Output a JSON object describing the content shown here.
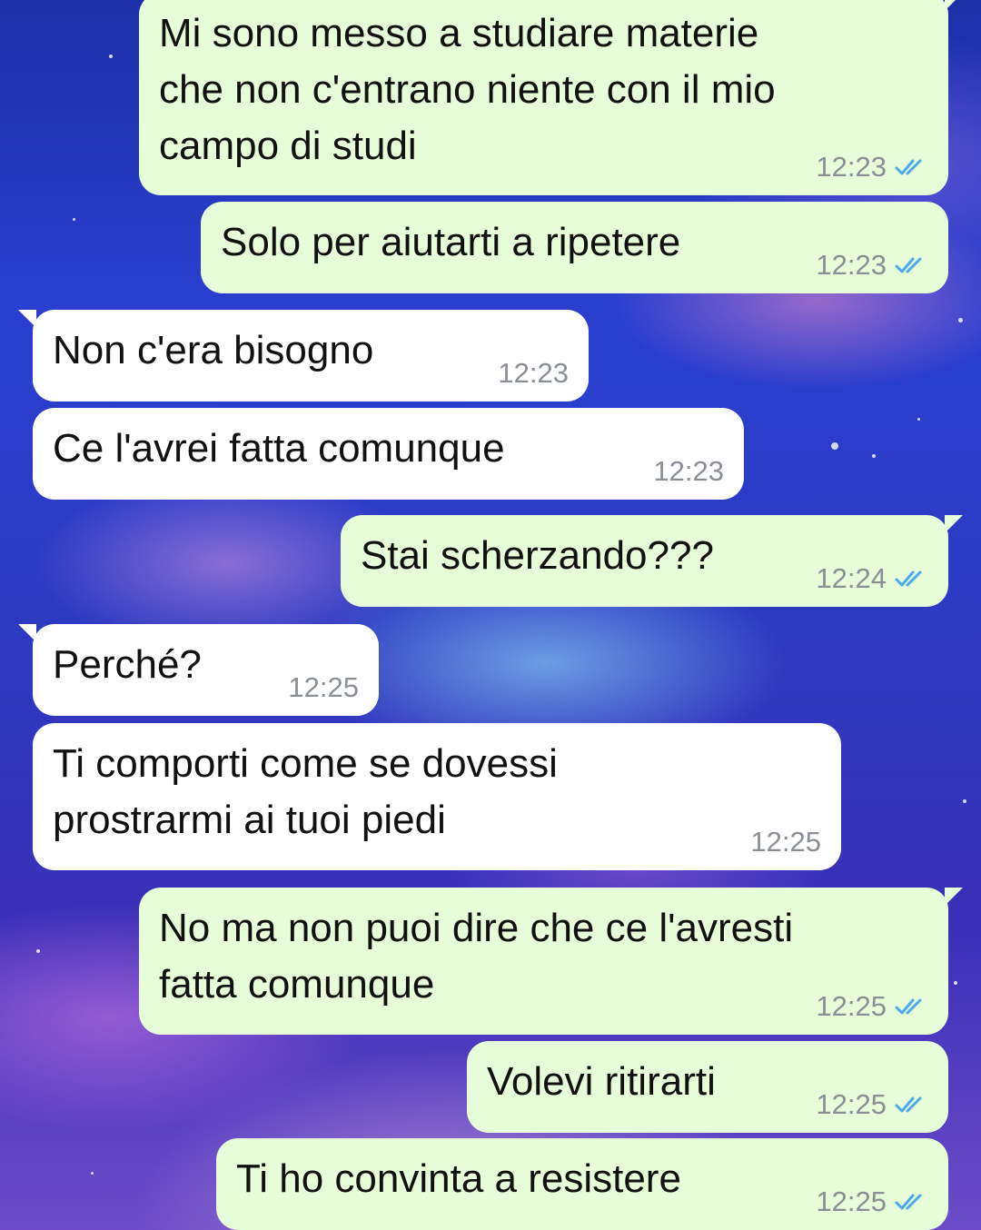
{
  "colors": {
    "outgoing_bubble": "#e7fcd8",
    "incoming_bubble": "#ffffff",
    "read_ticks": "#4fa8e8",
    "time_text": "#8a8f95"
  },
  "messages": [
    {
      "direction": "outgoing",
      "text_lines": [
        "Mi sono messo a studiare materie",
        "che non c'entrano niente con il mio",
        "campo di studi"
      ],
      "time": "12:23",
      "status": "read"
    },
    {
      "direction": "outgoing",
      "text_lines": [
        "Solo per aiutarti a ripetere"
      ],
      "time": "12:23",
      "status": "read"
    },
    {
      "direction": "incoming",
      "text_lines": [
        "Non c'era bisogno"
      ],
      "time": "12:23"
    },
    {
      "direction": "incoming",
      "text_lines": [
        "Ce l'avrei fatta comunque"
      ],
      "time": "12:23"
    },
    {
      "direction": "outgoing",
      "text_lines": [
        "Stai scherzando???"
      ],
      "time": "12:24",
      "status": "read"
    },
    {
      "direction": "incoming",
      "text_lines": [
        "Perché?"
      ],
      "time": "12:25"
    },
    {
      "direction": "incoming",
      "text_lines": [
        "Ti comporti come se dovessi",
        "prostrarmi ai tuoi piedi"
      ],
      "time": "12:25"
    },
    {
      "direction": "outgoing",
      "text_lines": [
        "No ma non puoi dire che ce l'avresti",
        "fatta comunque"
      ],
      "time": "12:25",
      "status": "read"
    },
    {
      "direction": "outgoing",
      "text_lines": [
        "Volevi ritirarti"
      ],
      "time": "12:25",
      "status": "read"
    },
    {
      "direction": "outgoing",
      "text_lines": [
        "Ti ho convinta a resistere"
      ],
      "time": "12:25",
      "status": "read"
    }
  ]
}
